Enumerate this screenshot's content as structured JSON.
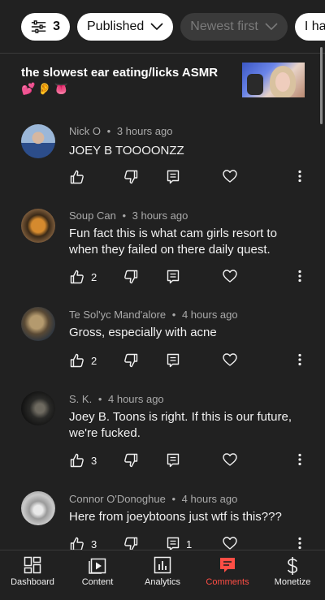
{
  "filters": {
    "count": "3",
    "status": "Published",
    "sort": "Newest first",
    "partial_chip": "I ha"
  },
  "video": {
    "title": "the slowest ear eating/licks ASMR",
    "emojis": "💕👂👅"
  },
  "comments": [
    {
      "author": "Nick O",
      "time": "3 hours ago",
      "text": "JOEY B TOOOONZZ",
      "likes": "",
      "replies": ""
    },
    {
      "author": "Soup Can",
      "time": "3 hours ago",
      "text": "Fun fact this is what cam girls resort to when they failed on there daily quest.",
      "likes": "2",
      "replies": ""
    },
    {
      "author": "Te Sol'yc Mand'alore",
      "time": "4 hours ago",
      "text": "Gross, especially with acne",
      "likes": "2",
      "replies": ""
    },
    {
      "author": "S. K.",
      "time": "4 hours ago",
      "text": "Joey B. Toons is right. If this is our future, we're fucked.",
      "likes": "3",
      "replies": ""
    },
    {
      "author": "Connor O'Donoghue",
      "time": "4 hours ago",
      "text": "Here from joeybtoons just wtf is this???",
      "likes": "3",
      "replies": "1"
    }
  ],
  "meta_separator": "•",
  "nav": [
    {
      "label": "Dashboard",
      "icon": "dashboard-icon"
    },
    {
      "label": "Content",
      "icon": "content-icon"
    },
    {
      "label": "Analytics",
      "icon": "analytics-icon"
    },
    {
      "label": "Comments",
      "icon": "comments-icon",
      "active": true
    },
    {
      "label": "Monetize",
      "icon": "monetize-icon"
    }
  ],
  "colors": {
    "background": "#212121",
    "accent": "#ff4e45",
    "meta": "#aaaaaa"
  }
}
